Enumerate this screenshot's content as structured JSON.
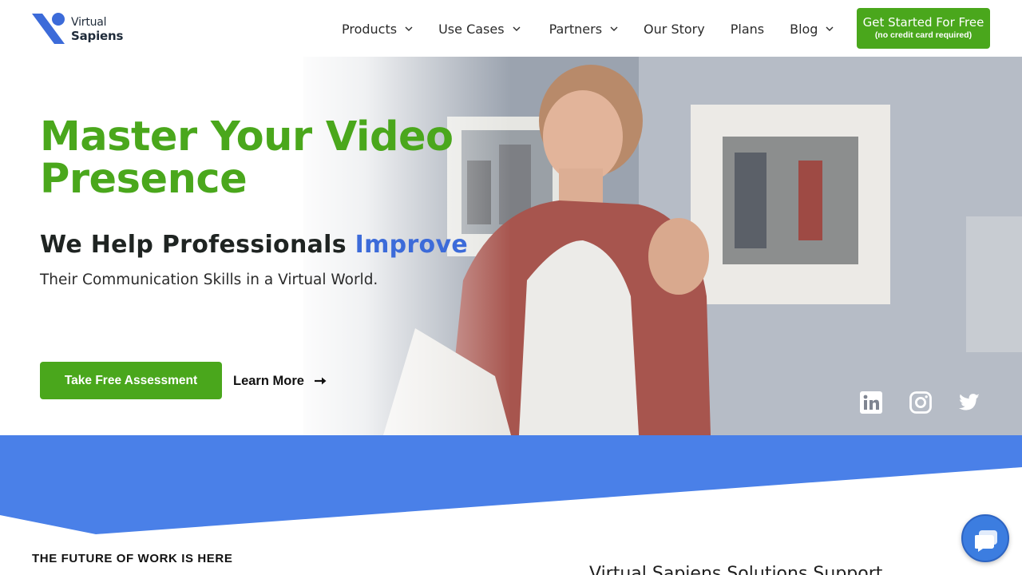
{
  "brand": {
    "line1": "Virtual",
    "line2": "Sapiens"
  },
  "nav": {
    "items": [
      {
        "label": "Products",
        "dropdown": true
      },
      {
        "label": "Use Cases",
        "dropdown": true
      },
      {
        "label": "Partners",
        "dropdown": true
      },
      {
        "label": "Our Story",
        "dropdown": false
      },
      {
        "label": "Plans",
        "dropdown": false
      },
      {
        "label": "Blog",
        "dropdown": true
      }
    ],
    "cta": {
      "label": "Get Started For Free",
      "sublabel": "(no credit card required)"
    }
  },
  "hero": {
    "title_line1": "Master Your Video",
    "title_line2": "Presence",
    "subtitle_prefix": "We Help Professionals ",
    "subtitle_accent": "Improve",
    "description": "Their Communication Skills in a Virtual World.",
    "primary_button": "Take Free Assessment",
    "secondary_button": "Learn More"
  },
  "social": {
    "icons": [
      "linkedin-icon",
      "instagram-icon",
      "twitter-icon"
    ]
  },
  "section": {
    "label": "THE FUTURE OF WORK IS HERE",
    "right_heading": "Virtual Sapiens Solutions Support"
  },
  "colors": {
    "brand_green": "#4aa71c",
    "accent_blue": "#3c6bd9",
    "band_blue": "#4a80e8",
    "chat_blue": "#3c7de0"
  }
}
